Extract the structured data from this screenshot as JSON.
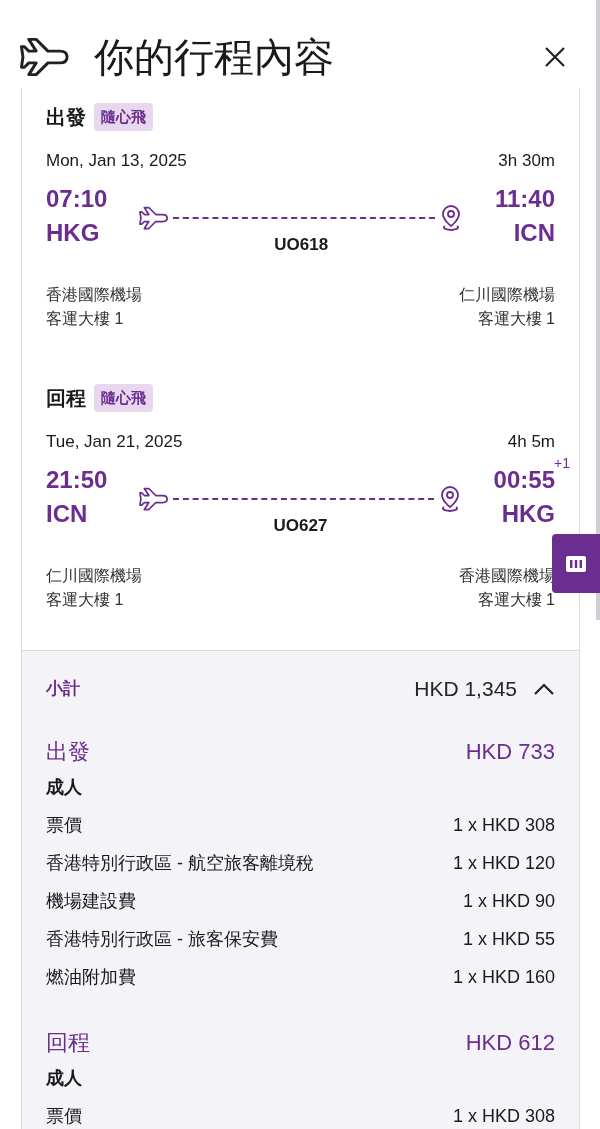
{
  "header": {
    "title": "你的行程內容"
  },
  "segments": [
    {
      "label": "出發",
      "tag": "隨心飛",
      "date": "Mon, Jan 13, 2025",
      "duration": "3h 30m",
      "depart_time": "07:10",
      "depart_code": "HKG",
      "arrive_time": "11:40",
      "arrive_code": "ICN",
      "flight": "UO618",
      "depart_airport": "香港國際機場",
      "depart_terminal": "客運大樓 1",
      "arrive_airport": "仁川國際機場",
      "arrive_terminal": "客運大樓 1"
    },
    {
      "label": "回程",
      "tag": "隨心飛",
      "date": "Tue, Jan 21, 2025",
      "duration": "4h 5m",
      "depart_time": "21:50",
      "depart_code": "ICN",
      "arrive_time": "00:55",
      "day_offset": "+1",
      "arrive_code": "HKG",
      "flight": "UO627",
      "depart_airport": "仁川國際機場",
      "depart_terminal": "客運大樓 1",
      "arrive_airport": "香港國際機場",
      "arrive_terminal": "客運大樓 1"
    }
  ],
  "summary": {
    "label": "小計",
    "total": "HKD 1,345",
    "expanded": true,
    "groups": [
      {
        "label": "出發",
        "amount": "HKD 733",
        "passenger": "成人",
        "items": [
          {
            "name": "票價",
            "price": "1 x HKD 308"
          },
          {
            "name": "香港特別行政區 - 航空旅客離境稅",
            "price": "1 x HKD 120"
          },
          {
            "name": "機場建設費",
            "price": "1 x HKD 90"
          },
          {
            "name": "香港特別行政區 - 旅客保安費",
            "price": "1 x HKD 55"
          },
          {
            "name": "燃油附加費",
            "price": "1 x HKD 160"
          }
        ]
      },
      {
        "label": "回程",
        "amount": "HKD 612",
        "passenger": "成人",
        "items": [
          {
            "name": "票價",
            "price": "1 x HKD 308"
          }
        ]
      }
    ]
  }
}
